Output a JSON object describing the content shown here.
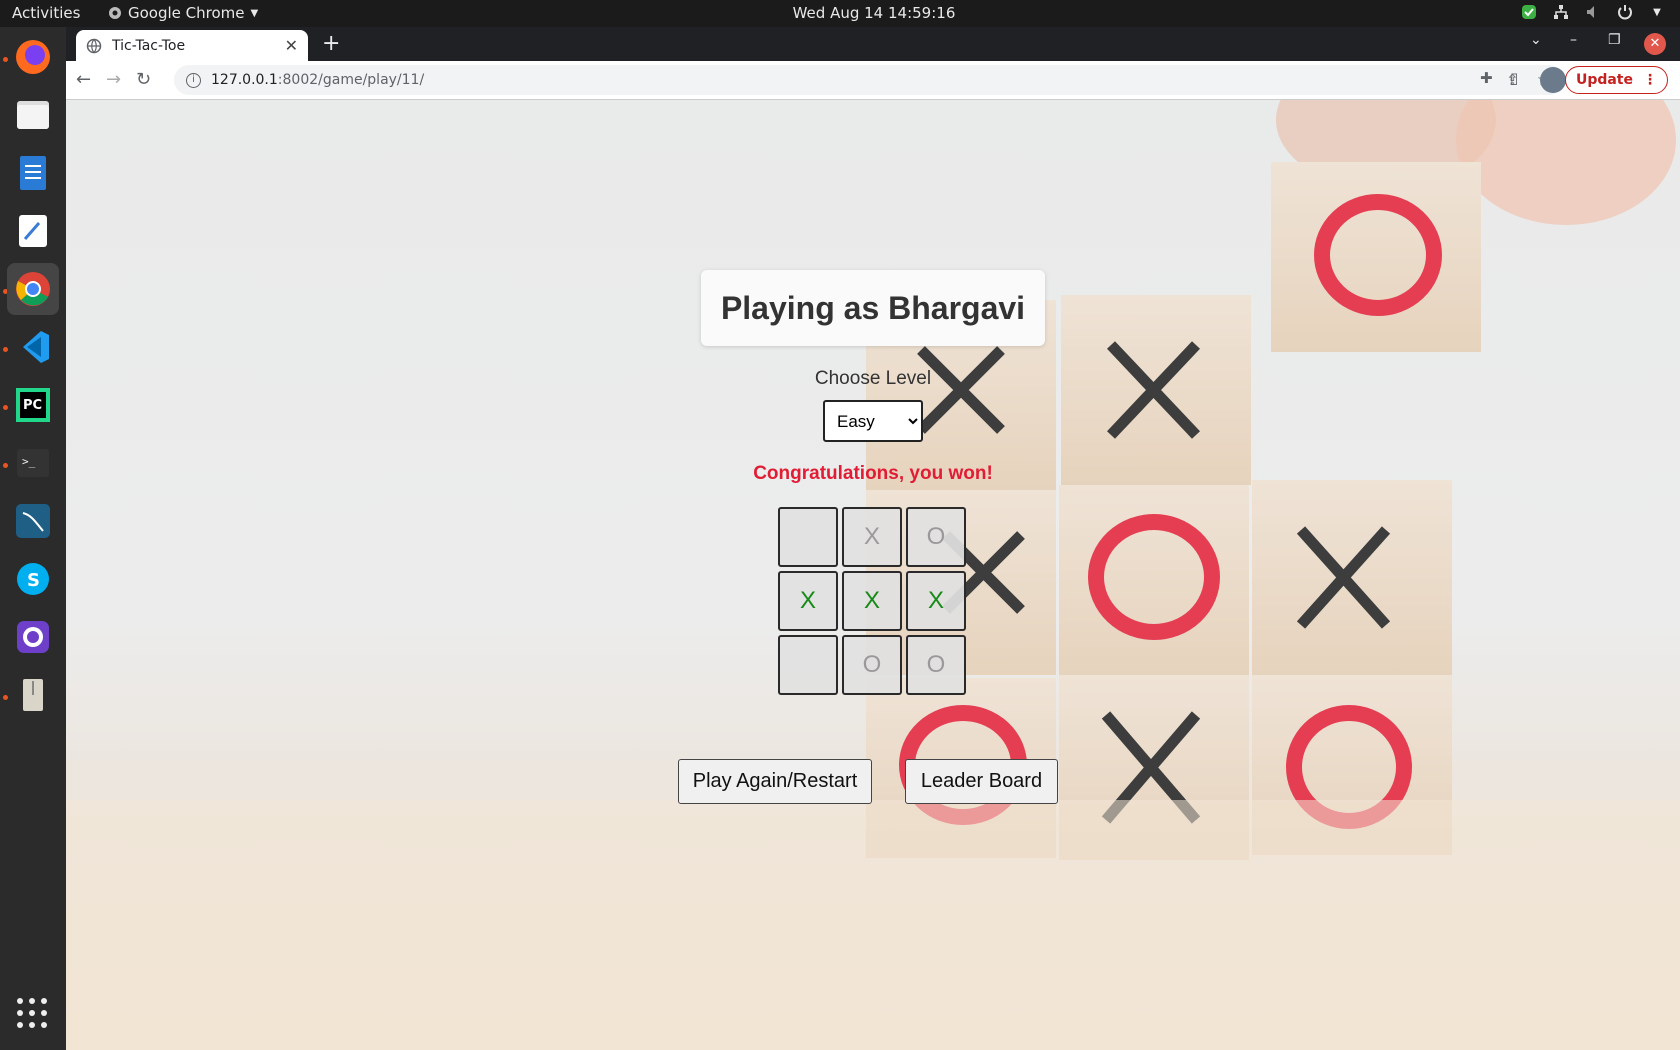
{
  "os": {
    "activities": "Activities",
    "app_name": "Google Chrome",
    "datetime": "Wed Aug 14  14:59:16"
  },
  "dock": {
    "apps": [
      "firefox-icon",
      "files-icon",
      "writer-icon",
      "text-editor-icon",
      "chrome-icon",
      "vscode-icon",
      "pycharm-icon",
      "terminal-icon",
      "mysql-workbench-icon",
      "skype-icon",
      "github-desktop-icon",
      "archive-icon"
    ]
  },
  "browser": {
    "tab_title": "Tic-Tac-Toe",
    "url_host": "127.0.0.1",
    "url_path": ":8002/game/play/11/",
    "update_label": "Update"
  },
  "game": {
    "heading": "Playing as Bhargavi",
    "level_label": "Choose Level",
    "level_selected": "Easy",
    "level_options": [
      "Easy"
    ],
    "message": "Congratulations, you won!",
    "board": [
      "",
      "X",
      "O",
      "X",
      "X",
      "X",
      "",
      "O",
      "O"
    ],
    "winning_cells": [
      3,
      4,
      5
    ],
    "restart_label": "Play Again/Restart",
    "leaderboard_label": "Leader Board",
    "colors": {
      "message": "#e11d35",
      "win_mark": "#168a16",
      "mark": "#9a9a9a"
    }
  }
}
